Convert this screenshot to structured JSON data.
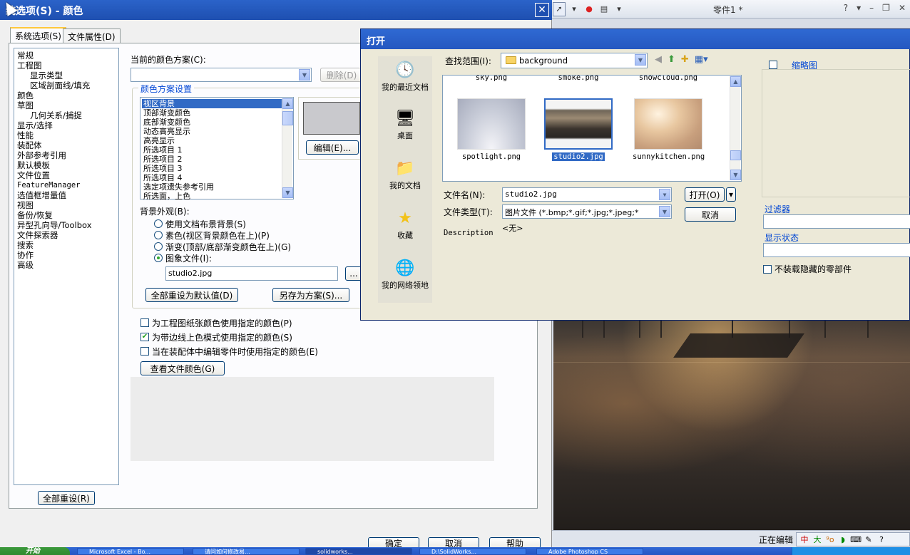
{
  "colors": {
    "title_blue": "#2b63c9",
    "selection": "#316ac5",
    "group_blue": "#0046d5"
  },
  "sys_dialog": {
    "title": "统选项(S) - 颜色",
    "close_glyph": "✕",
    "tabs": [
      {
        "label": "系统选项(S)",
        "active": true
      },
      {
        "label": "文件属性(D)",
        "active": false
      }
    ],
    "tree": [
      {
        "label": "常规",
        "level": 0
      },
      {
        "label": "工程图",
        "level": 0
      },
      {
        "label": "显示类型",
        "level": 1
      },
      {
        "label": "区域剖面线/填充",
        "level": 1
      },
      {
        "label": "颜色",
        "level": 0
      },
      {
        "label": "草图",
        "level": 0
      },
      {
        "label": "几何关系/捕捉",
        "level": 1
      },
      {
        "label": "显示/选择",
        "level": 0
      },
      {
        "label": "性能",
        "level": 0
      },
      {
        "label": "装配体",
        "level": 0
      },
      {
        "label": "外部参考引用",
        "level": 0
      },
      {
        "label": "默认模板",
        "level": 0
      },
      {
        "label": "文件位置",
        "level": 0
      },
      {
        "label": "FeatureManager",
        "level": 0
      },
      {
        "label": "选值框增量值",
        "level": 0
      },
      {
        "label": "视图",
        "level": 0
      },
      {
        "label": "备份/恢复",
        "level": 0
      },
      {
        "label": "异型孔向导/Toolbox",
        "level": 0
      },
      {
        "label": "文件探索器",
        "level": 0
      },
      {
        "label": "搜索",
        "level": 0
      },
      {
        "label": "协作",
        "level": 0
      },
      {
        "label": "高级",
        "level": 0
      }
    ],
    "reset_all_label": "全部重设(R)",
    "scheme_label": "当前的颜色方案(C):",
    "scheme_value": "",
    "delete_label": "删除(D)",
    "scheme_group_label": "颜色方案设置",
    "color_items": [
      "视区背景",
      "顶部渐变颜色",
      "底部渐变颜色",
      "动态高亮显示",
      "高亮显示",
      "所选项目 1",
      "所选项目 2",
      "所选项目 3",
      "所选项目 4",
      "选定项遗失参考引用",
      "所选面，上色"
    ],
    "selected_color_index": 0,
    "edit_label": "编辑(E)...",
    "bg_appearance_label": "背景外观(B):",
    "bg_options": [
      {
        "label": "使用文档布景背景(S)",
        "checked": false
      },
      {
        "label": "素色(视区背景颜色在上)(P)",
        "checked": false
      },
      {
        "label": "渐变(顶部/底部渐变颜色在上)(G)",
        "checked": false
      },
      {
        "label": "图象文件(I):",
        "checked": true
      }
    ],
    "image_file": "studio2.jpg",
    "browse_label": "...",
    "reset_default_label": "全部重设为默认值(D)",
    "save_scheme_label": "另存为方案(S)...",
    "checks": [
      {
        "label": "为工程图纸张颜色使用指定的颜色(P)",
        "checked": false
      },
      {
        "label": "为带边线上色模式使用指定的颜色(S)",
        "checked": true
      },
      {
        "label": "当在装配体中编辑零件时使用指定的颜色(E)",
        "checked": false
      }
    ],
    "view_doc_colors_label": "查看文件颜色(G)",
    "bottom_buttons": [
      "确定",
      "取消",
      "帮助"
    ]
  },
  "app": {
    "doc_title": "零件1 *",
    "win_ctrls": [
      "?",
      "▾",
      "–",
      "❐",
      "✕"
    ],
    "status_text": "正在编辑",
    "ime_glyphs": [
      "中",
      "大",
      "⁹o",
      "◗",
      "⌨",
      "✎",
      "?"
    ]
  },
  "open_dialog": {
    "title": "打开",
    "places": [
      {
        "label": "我的最近文档",
        "icon": "recent-docs-icon",
        "glyph": "🕓"
      },
      {
        "label": "桌面",
        "icon": "desktop-icon",
        "glyph": "🖥"
      },
      {
        "label": "我的文档",
        "icon": "my-documents-icon",
        "glyph": "📁"
      },
      {
        "label": "收藏",
        "icon": "favorites-icon",
        "glyph": "★"
      },
      {
        "label": "我的网络领地",
        "icon": "network-places-icon",
        "glyph": "🌐"
      }
    ],
    "lookin_label": "查找范围(I):",
    "lookin_value": "background",
    "top_row_files": [
      "sky.png",
      "smoke.png",
      "snowcloud.png"
    ],
    "files": [
      {
        "name": "spotlight.png",
        "selected": false,
        "swatch": "spotlight"
      },
      {
        "name": "studio2.jpg",
        "selected": true,
        "swatch": "studio"
      },
      {
        "name": "sunnykitchen.png",
        "selected": false,
        "swatch": "kitchen"
      }
    ],
    "filename_label": "文件名(N):",
    "filename_value": "studio2.jpg",
    "filetype_label": "文件类型(T):",
    "filetype_value": "图片文件 (*.bmp;*.gif;*.jpg;*.jpeg;*",
    "open_label": "打开(O)",
    "cancel_label": "取消",
    "desc_label": "Description",
    "desc_value": "<无>",
    "thumb_label": "缩略图",
    "filter_label": "过滤器",
    "display_state_label": "显示状态",
    "hidden_parts_label": "不装载隐藏的零部件"
  },
  "taskbar": {
    "start_label": "开始",
    "tasks": [
      "Microsoft Excel - Bo...",
      "请问如何修改易...",
      "solidworks...",
      "D:\\SolidWorks...",
      "Adobe Photoshop CS"
    ]
  }
}
